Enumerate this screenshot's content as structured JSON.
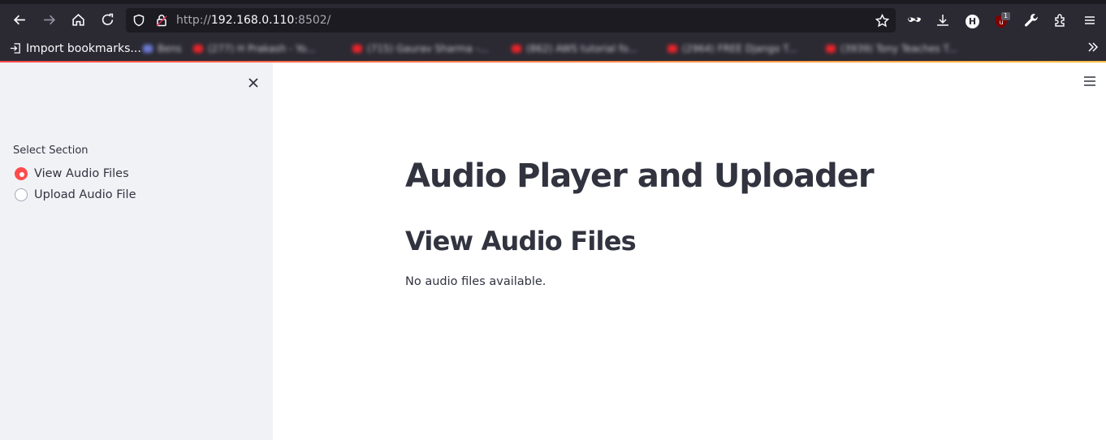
{
  "browser": {
    "url_prefix": "http://",
    "url_host": "192.168.0.110",
    "url_port": ":8502/",
    "extension_badge": "1",
    "extension_h_label": "H"
  },
  "bookmarks": {
    "import_label": "Import bookmarks...",
    "blurred_items": [
      "Bens",
      "(277) H Prakash - Yo...",
      "(715) Gaurav Sharma -...",
      "(862) AWS tutorial fo...",
      "(2964) FREE Django T...",
      "(3939) Tony Teaches T..."
    ]
  },
  "sidebar": {
    "section_label": "Select Section",
    "options": [
      {
        "label": "View Audio Files",
        "selected": true
      },
      {
        "label": "Upload Audio File",
        "selected": false
      }
    ]
  },
  "main": {
    "title": "Audio Player and Uploader",
    "section_heading": "View Audio Files",
    "message": "No audio files available."
  },
  "colors": {
    "accent": "#ff4b4b",
    "text": "#31333f",
    "sidebar_bg": "#f0f2f6",
    "chrome_bg": "#2b2a33"
  }
}
